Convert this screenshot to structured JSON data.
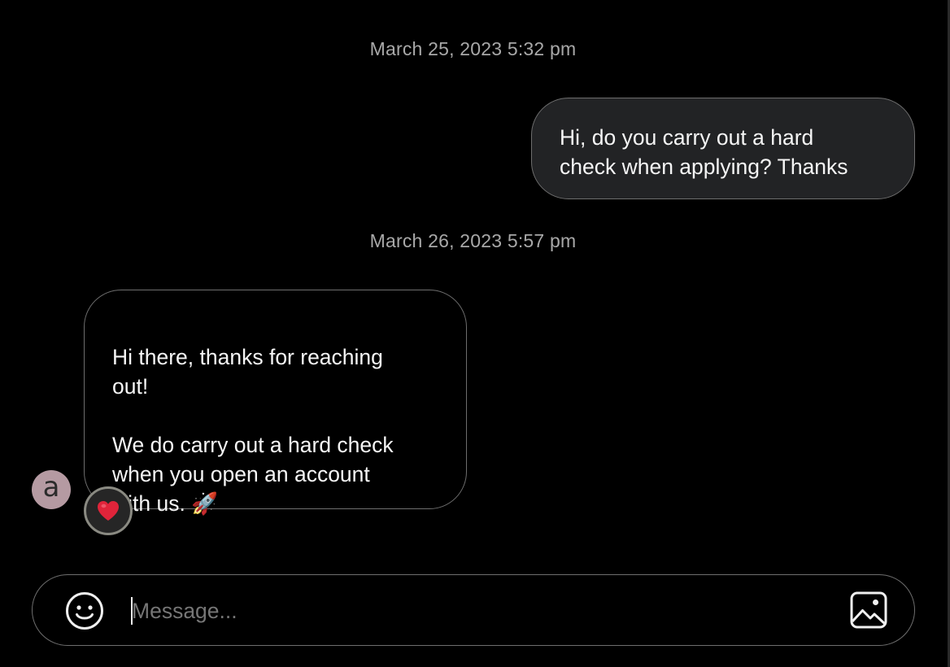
{
  "conversation": {
    "messages": [
      {
        "timestamp": "March 25, 2023 5:32 pm",
        "direction": "outgoing",
        "text": "Hi, do you carry out a hard\ncheck when applying? Thanks"
      },
      {
        "timestamp": "March 26, 2023 5:57 pm",
        "direction": "incoming",
        "text": "Hi there, thanks for reaching\nout!\n\nWe do carry out a hard check\nwhen you open an account\nwith us. 🚀",
        "sender_avatar_letter": "a",
        "reaction": "heart-emoji"
      }
    ]
  },
  "composer": {
    "placeholder": "Message...",
    "value": "",
    "emoji_icon": "smiley-face-icon",
    "image_icon": "image-icon"
  },
  "colors": {
    "background": "#000000",
    "outgoing_bubble": "#222325",
    "bubble_border": "#6e6e6e",
    "timestamp_text": "#a8a8a8",
    "avatar_bg": "#b59aa2",
    "reaction_heart": "#e0243a"
  }
}
